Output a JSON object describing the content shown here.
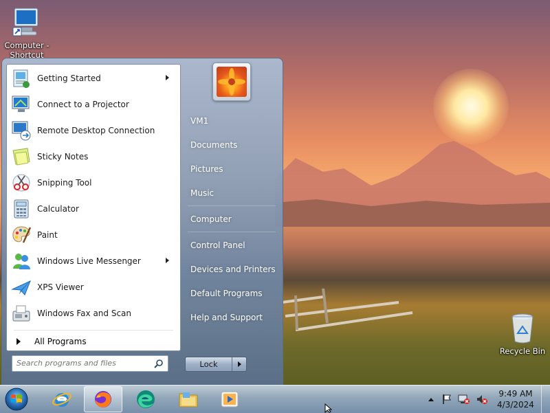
{
  "desktop": {
    "computer_shortcut_label": "Computer - Shortcut",
    "recycle_bin_label": "Recycle Bin"
  },
  "start_menu": {
    "programs": [
      {
        "label": "Getting Started",
        "icon": "getting-started-icon",
        "submenu": true
      },
      {
        "label": "Connect to a Projector",
        "icon": "projector-icon",
        "submenu": false
      },
      {
        "label": "Remote Desktop Connection",
        "icon": "remote-desktop-icon",
        "submenu": false
      },
      {
        "label": "Sticky Notes",
        "icon": "sticky-notes-icon",
        "submenu": false
      },
      {
        "label": "Snipping Tool",
        "icon": "scissors-icon",
        "submenu": false
      },
      {
        "label": "Calculator",
        "icon": "calculator-icon",
        "submenu": false
      },
      {
        "label": "Paint",
        "icon": "paint-palette-icon",
        "submenu": false
      },
      {
        "label": "Windows Live Messenger",
        "icon": "messenger-icon",
        "submenu": true
      },
      {
        "label": "XPS Viewer",
        "icon": "xps-viewer-icon",
        "submenu": false
      },
      {
        "label": "Windows Fax and Scan",
        "icon": "fax-icon",
        "submenu": false
      }
    ],
    "all_programs_label": "All Programs",
    "search_placeholder": "Search programs and files",
    "right_items": {
      "user": "VM1",
      "documents": "Documents",
      "pictures": "Pictures",
      "music": "Music",
      "computer": "Computer",
      "control_panel": "Control Panel",
      "devices_printers": "Devices and Printers",
      "default_programs": "Default Programs",
      "help_support": "Help and Support"
    },
    "lock_label": "Lock"
  },
  "taskbar": {
    "pinned": [
      "internet-explorer-icon",
      "firefox-icon",
      "edge-icon",
      "file-explorer-icon",
      "media-player-icon"
    ],
    "active_pinned": "firefox-icon",
    "clock_time": "9:49 AM",
    "clock_date": "4/3/2024"
  },
  "colors": {
    "menu_accent": "#6e84a0",
    "taskbar": "#96acc6"
  }
}
